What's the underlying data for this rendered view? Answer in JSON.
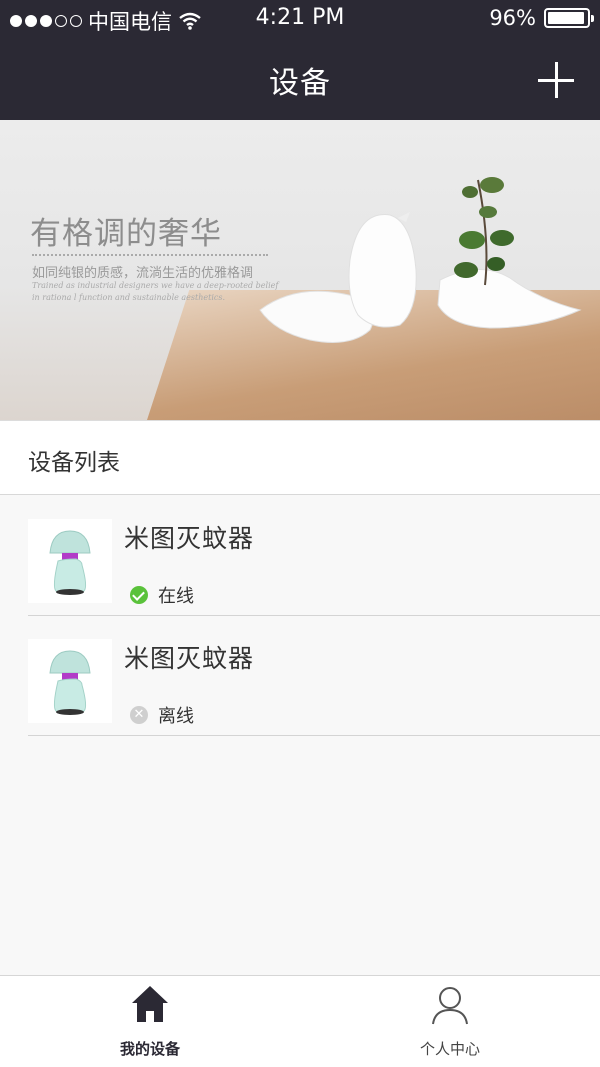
{
  "status_bar": {
    "carrier": "中国电信",
    "time": "4:21 PM",
    "battery": "96%",
    "battery_level": 0.96,
    "signal_bars": 3
  },
  "nav": {
    "title": "设备",
    "add_icon": "plus-icon"
  },
  "banner": {
    "headline": "有格调的奢华",
    "subtitle": "如同纯银的质感，流淌生活的优雅格调",
    "english": "Trained as industrial designers we have a deep-rooted belief in rationa l function and sustainable aesthetics."
  },
  "device_list": {
    "header": "设备列表",
    "items": [
      {
        "name": "米图灭蚊器",
        "status": "在线",
        "state": "online",
        "icon": "mosquito-lamp-image"
      },
      {
        "name": "米图灭蚊器",
        "status": "离线",
        "state": "offline",
        "icon": "mosquito-lamp-image"
      }
    ]
  },
  "tabbar": {
    "tabs": [
      {
        "label": "我的设备",
        "icon": "home-icon",
        "active": true
      },
      {
        "label": "个人中心",
        "icon": "person-icon",
        "active": false
      }
    ]
  },
  "colors": {
    "nav_background": "#2b2934",
    "online": "#5ac23b",
    "offline": "#cfcfcf"
  }
}
